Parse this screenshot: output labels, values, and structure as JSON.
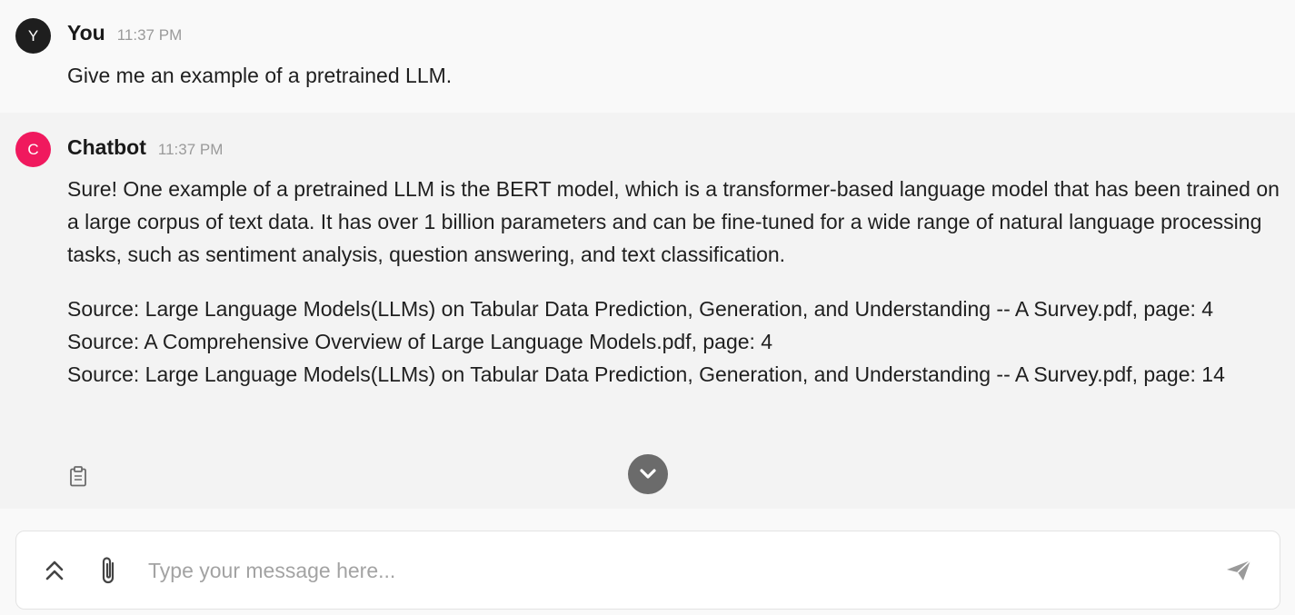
{
  "messages": {
    "user": {
      "avatar_letter": "Y",
      "name": "You",
      "time": "11:37 PM",
      "text": "Give me an example of a pretrained LLM."
    },
    "bot": {
      "avatar_letter": "C",
      "name": "Chatbot",
      "time": "11:37 PM",
      "text": "Sure! One example of a pretrained LLM is the BERT model, which is a transformer-based language model that has been trained on a large corpus of text data. It has over 1 billion parameters and can be fine-tuned for a wide range of natural language processing tasks, such as sentiment analysis, question answering, and text classification.",
      "sources": [
        "Source: Large Language Models(LLMs) on Tabular Data Prediction, Generation, and Understanding -- A Survey.pdf, page: 4",
        "Source: A Comprehensive Overview of Large Language Models.pdf, page: 4",
        "Source: Large Language Models(LLMs) on Tabular Data Prediction, Generation, and Understanding -- A Survey.pdf, page: 14"
      ]
    }
  },
  "composer": {
    "placeholder": "Type your message here...",
    "value": ""
  },
  "icons": {
    "copy": "clipboard-icon",
    "scroll_down": "chevron-down-icon",
    "expand": "double-chevron-up-icon",
    "attach": "paperclip-icon",
    "send": "send-icon"
  },
  "colors": {
    "user_avatar": "#1e1e1e",
    "bot_avatar": "#f0195e",
    "bot_background": "#f3f3f3",
    "scroll_button": "#6b6b6b"
  }
}
